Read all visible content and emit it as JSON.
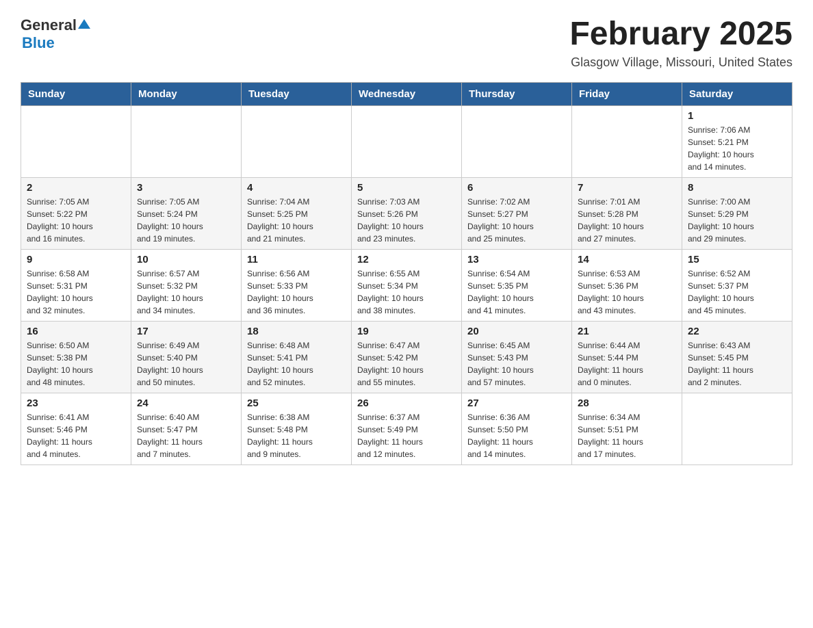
{
  "header": {
    "logo_general": "General",
    "logo_blue": "Blue",
    "month_title": "February 2025",
    "location": "Glasgow Village, Missouri, United States"
  },
  "weekdays": [
    "Sunday",
    "Monday",
    "Tuesday",
    "Wednesday",
    "Thursday",
    "Friday",
    "Saturday"
  ],
  "weeks": [
    {
      "days": [
        {
          "num": "",
          "info": ""
        },
        {
          "num": "",
          "info": ""
        },
        {
          "num": "",
          "info": ""
        },
        {
          "num": "",
          "info": ""
        },
        {
          "num": "",
          "info": ""
        },
        {
          "num": "",
          "info": ""
        },
        {
          "num": "1",
          "info": "Sunrise: 7:06 AM\nSunset: 5:21 PM\nDaylight: 10 hours\nand 14 minutes."
        }
      ]
    },
    {
      "days": [
        {
          "num": "2",
          "info": "Sunrise: 7:05 AM\nSunset: 5:22 PM\nDaylight: 10 hours\nand 16 minutes."
        },
        {
          "num": "3",
          "info": "Sunrise: 7:05 AM\nSunset: 5:24 PM\nDaylight: 10 hours\nand 19 minutes."
        },
        {
          "num": "4",
          "info": "Sunrise: 7:04 AM\nSunset: 5:25 PM\nDaylight: 10 hours\nand 21 minutes."
        },
        {
          "num": "5",
          "info": "Sunrise: 7:03 AM\nSunset: 5:26 PM\nDaylight: 10 hours\nand 23 minutes."
        },
        {
          "num": "6",
          "info": "Sunrise: 7:02 AM\nSunset: 5:27 PM\nDaylight: 10 hours\nand 25 minutes."
        },
        {
          "num": "7",
          "info": "Sunrise: 7:01 AM\nSunset: 5:28 PM\nDaylight: 10 hours\nand 27 minutes."
        },
        {
          "num": "8",
          "info": "Sunrise: 7:00 AM\nSunset: 5:29 PM\nDaylight: 10 hours\nand 29 minutes."
        }
      ]
    },
    {
      "days": [
        {
          "num": "9",
          "info": "Sunrise: 6:58 AM\nSunset: 5:31 PM\nDaylight: 10 hours\nand 32 minutes."
        },
        {
          "num": "10",
          "info": "Sunrise: 6:57 AM\nSunset: 5:32 PM\nDaylight: 10 hours\nand 34 minutes."
        },
        {
          "num": "11",
          "info": "Sunrise: 6:56 AM\nSunset: 5:33 PM\nDaylight: 10 hours\nand 36 minutes."
        },
        {
          "num": "12",
          "info": "Sunrise: 6:55 AM\nSunset: 5:34 PM\nDaylight: 10 hours\nand 38 minutes."
        },
        {
          "num": "13",
          "info": "Sunrise: 6:54 AM\nSunset: 5:35 PM\nDaylight: 10 hours\nand 41 minutes."
        },
        {
          "num": "14",
          "info": "Sunrise: 6:53 AM\nSunset: 5:36 PM\nDaylight: 10 hours\nand 43 minutes."
        },
        {
          "num": "15",
          "info": "Sunrise: 6:52 AM\nSunset: 5:37 PM\nDaylight: 10 hours\nand 45 minutes."
        }
      ]
    },
    {
      "days": [
        {
          "num": "16",
          "info": "Sunrise: 6:50 AM\nSunset: 5:38 PM\nDaylight: 10 hours\nand 48 minutes."
        },
        {
          "num": "17",
          "info": "Sunrise: 6:49 AM\nSunset: 5:40 PM\nDaylight: 10 hours\nand 50 minutes."
        },
        {
          "num": "18",
          "info": "Sunrise: 6:48 AM\nSunset: 5:41 PM\nDaylight: 10 hours\nand 52 minutes."
        },
        {
          "num": "19",
          "info": "Sunrise: 6:47 AM\nSunset: 5:42 PM\nDaylight: 10 hours\nand 55 minutes."
        },
        {
          "num": "20",
          "info": "Sunrise: 6:45 AM\nSunset: 5:43 PM\nDaylight: 10 hours\nand 57 minutes."
        },
        {
          "num": "21",
          "info": "Sunrise: 6:44 AM\nSunset: 5:44 PM\nDaylight: 11 hours\nand 0 minutes."
        },
        {
          "num": "22",
          "info": "Sunrise: 6:43 AM\nSunset: 5:45 PM\nDaylight: 11 hours\nand 2 minutes."
        }
      ]
    },
    {
      "days": [
        {
          "num": "23",
          "info": "Sunrise: 6:41 AM\nSunset: 5:46 PM\nDaylight: 11 hours\nand 4 minutes."
        },
        {
          "num": "24",
          "info": "Sunrise: 6:40 AM\nSunset: 5:47 PM\nDaylight: 11 hours\nand 7 minutes."
        },
        {
          "num": "25",
          "info": "Sunrise: 6:38 AM\nSunset: 5:48 PM\nDaylight: 11 hours\nand 9 minutes."
        },
        {
          "num": "26",
          "info": "Sunrise: 6:37 AM\nSunset: 5:49 PM\nDaylight: 11 hours\nand 12 minutes."
        },
        {
          "num": "27",
          "info": "Sunrise: 6:36 AM\nSunset: 5:50 PM\nDaylight: 11 hours\nand 14 minutes."
        },
        {
          "num": "28",
          "info": "Sunrise: 6:34 AM\nSunset: 5:51 PM\nDaylight: 11 hours\nand 17 minutes."
        },
        {
          "num": "",
          "info": ""
        }
      ]
    }
  ]
}
